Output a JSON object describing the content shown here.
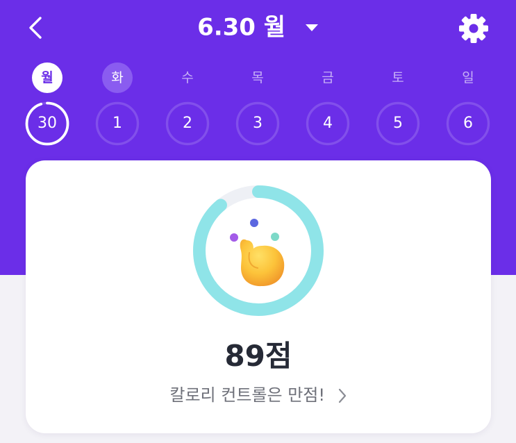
{
  "header": {
    "date_label": "6.30 월",
    "colors": {
      "background": "#6b2ee8",
      "text": "#ffffff"
    },
    "icons": {
      "back": "chevron-left-icon",
      "dropdown": "caret-down-icon",
      "settings": "gear-icon"
    }
  },
  "week": {
    "days": [
      {
        "label": "월",
        "date": "30",
        "state": "active",
        "progress": 0.95
      },
      {
        "label": "화",
        "date": "1",
        "state": "near",
        "progress": 0
      },
      {
        "label": "수",
        "date": "2",
        "state": "default",
        "progress": 0
      },
      {
        "label": "목",
        "date": "3",
        "state": "default",
        "progress": 0
      },
      {
        "label": "금",
        "date": "4",
        "state": "default",
        "progress": 0
      },
      {
        "label": "토",
        "date": "5",
        "state": "default",
        "progress": 0
      },
      {
        "label": "일",
        "date": "6",
        "state": "default",
        "progress": 0
      }
    ]
  },
  "score_card": {
    "score": "89점",
    "score_fraction": 0.89,
    "message": "칼로리 컨트롤은 만점!",
    "ring_color": "#8fe4e8",
    "ring_track_color": "#eef0f5",
    "icons": {
      "mascot": "thumbs-up-mascot-icon",
      "more": "chevron-right-icon"
    }
  }
}
